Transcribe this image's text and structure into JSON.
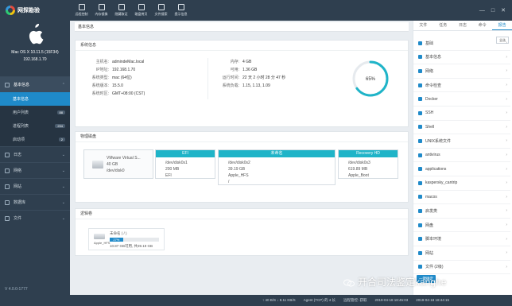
{
  "app": {
    "title": "网探勘验",
    "version": "V 4.0.0-1777"
  },
  "toolbar": [
    {
      "label": "远程控制",
      "icon": "remote-icon"
    },
    {
      "label": "内存镜像",
      "icon": "memory-icon"
    },
    {
      "label": "隐藏取证",
      "icon": "hidden-icon"
    },
    {
      "label": "磁盘拷贝",
      "icon": "disk-copy-icon"
    },
    {
      "label": "文件搜索",
      "icon": "search-icon"
    },
    {
      "label": "提示信息",
      "icon": "info-icon"
    }
  ],
  "device": {
    "os": "Mac OS X 10.11.5 (15F34)",
    "ip": "192.168.1.70"
  },
  "sidebar": {
    "items": [
      {
        "label": "基本信息",
        "expanded": true
      },
      {
        "label": "日志"
      },
      {
        "label": "网络"
      },
      {
        "label": "网站"
      },
      {
        "label": "数据库"
      },
      {
        "label": "文件"
      }
    ],
    "subitems": [
      {
        "label": "基本信息",
        "count": ""
      },
      {
        "label": "用户列表",
        "count": "88"
      },
      {
        "label": "进程列表",
        "count": "234"
      },
      {
        "label": "启动项",
        "count": "2"
      }
    ]
  },
  "main": {
    "breadcrumb": "基本信息",
    "sysinfo": {
      "title": "系统信息",
      "left": [
        {
          "k": "主机名:",
          "v": "admindeMac.local"
        },
        {
          "k": "IP地址:",
          "v": "192.168.1.70"
        },
        {
          "k": "系统类型:",
          "v": "mac (64位)"
        },
        {
          "k": "系统版本:",
          "v": "15.5.0"
        },
        {
          "k": "系统时区:",
          "v": "GMT+08:00 (CST)"
        }
      ],
      "right": [
        {
          "k": "内存:",
          "v": "4 GB"
        },
        {
          "k": "可用:",
          "v": "1.36 GB"
        },
        {
          "k": "运行时间:",
          "v": "22 天 2 小时 28 分 47 秒"
        },
        {
          "k": "系统负载:",
          "v": "1.15, 1.13, 1.09"
        }
      ],
      "memory_usage_percent": 65,
      "memory_usage_label": "65%"
    },
    "physical": {
      "title": "物理磁盘",
      "disk": {
        "name": "VMware Virtual S...",
        "size": "40 GB",
        "path": "/dev/disk0"
      },
      "partitions": [
        {
          "name": "EFI",
          "dev": "/dev/disk0s1",
          "size": "200 MB",
          "fs": "EFI"
        },
        {
          "name": "未命名",
          "dev": "/dev/disk0s2",
          "size": "39.19 GB",
          "fs": "Apple_HFS",
          "mount": "/"
        },
        {
          "name": "Recovery HD",
          "dev": "/dev/disk0s3",
          "size": "619.89 MB",
          "fs": "Apple_Boot"
        }
      ]
    },
    "logical": {
      "title": "逻辑卷",
      "volume": {
        "label": "未命名 ( / )",
        "fs": "Apple_HFS",
        "percent": 27,
        "percent_label": "27%",
        "usage": "10.87 GB可用, 共39.19 GB"
      }
    }
  },
  "right": {
    "tabs": [
      "文件",
      "任务",
      "日志",
      "命令",
      "报告"
    ],
    "active_tab": 4,
    "category_button": "全选",
    "categories": [
      "基础",
      "基本信息",
      "网络",
      "命令检查",
      "Docker",
      "SSH",
      "Shell",
      "UNIX系统文件",
      "antivirus",
      "applications",
      "kaspersky_cantrip",
      "macos",
      "启发类",
      "网盘",
      "脚本环境",
      "网站",
      "文件 (2级)"
    ],
    "apply_button": "一键确定"
  },
  "statusbar": [
    "↑ 40 B/S  ↓ 8.11 KB/S",
    "Agent (TCP) 的 4 长",
    "远程管控: 获取",
    "2019-04-18 18:45:03",
    "2019-04-18 18:44:15"
  ],
  "watermark": "开合司法鉴定kanghe"
}
